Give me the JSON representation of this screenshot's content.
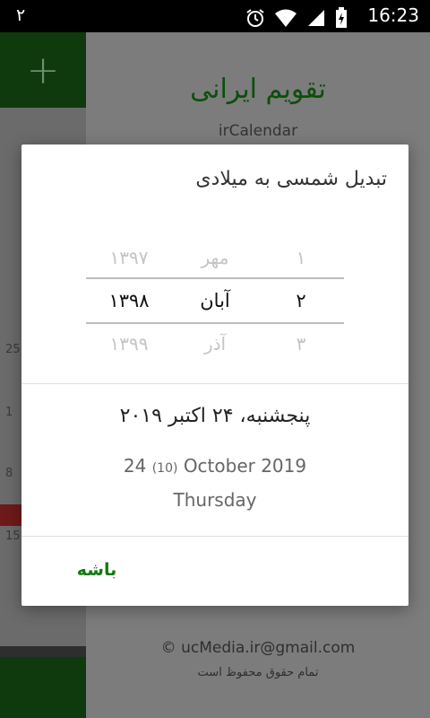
{
  "status_bar": {
    "notification": "٢",
    "time": "16:23",
    "icons": [
      "alarm-icon",
      "wifi-icon",
      "signal-icon",
      "battery-charging-icon"
    ]
  },
  "background_app": {
    "title": "تقویم ایرانی",
    "subtitle": "irCalendar",
    "email": "© ucMedia.ir@gmail.com",
    "rights": "تمام حقوق محفوظ است",
    "calendar_numbers": [
      "25",
      "1",
      "8",
      "15"
    ],
    "accent_color": "#0e3a0e"
  },
  "dialog": {
    "title": "تبدیل شمسی به میلادی",
    "picker": {
      "year": {
        "prev": "۱۳۹۷",
        "current": "۱۳۹۸",
        "next": "۱۳۹۹"
      },
      "month": {
        "prev": "مهر",
        "current": "آبان",
        "next": "آذر"
      },
      "day": {
        "prev": "۱",
        "current": "۲",
        "next": "۳"
      }
    },
    "result": {
      "persian_date": "پنجشنبه، ۲۴ اکتبر ۲۰۱۹",
      "gregorian_day": "24",
      "gregorian_month_num": "(10)",
      "gregorian_month_year": "October 2019",
      "weekday": "Thursday"
    },
    "ok_label": "باشه",
    "ok_color": "#117a11"
  }
}
